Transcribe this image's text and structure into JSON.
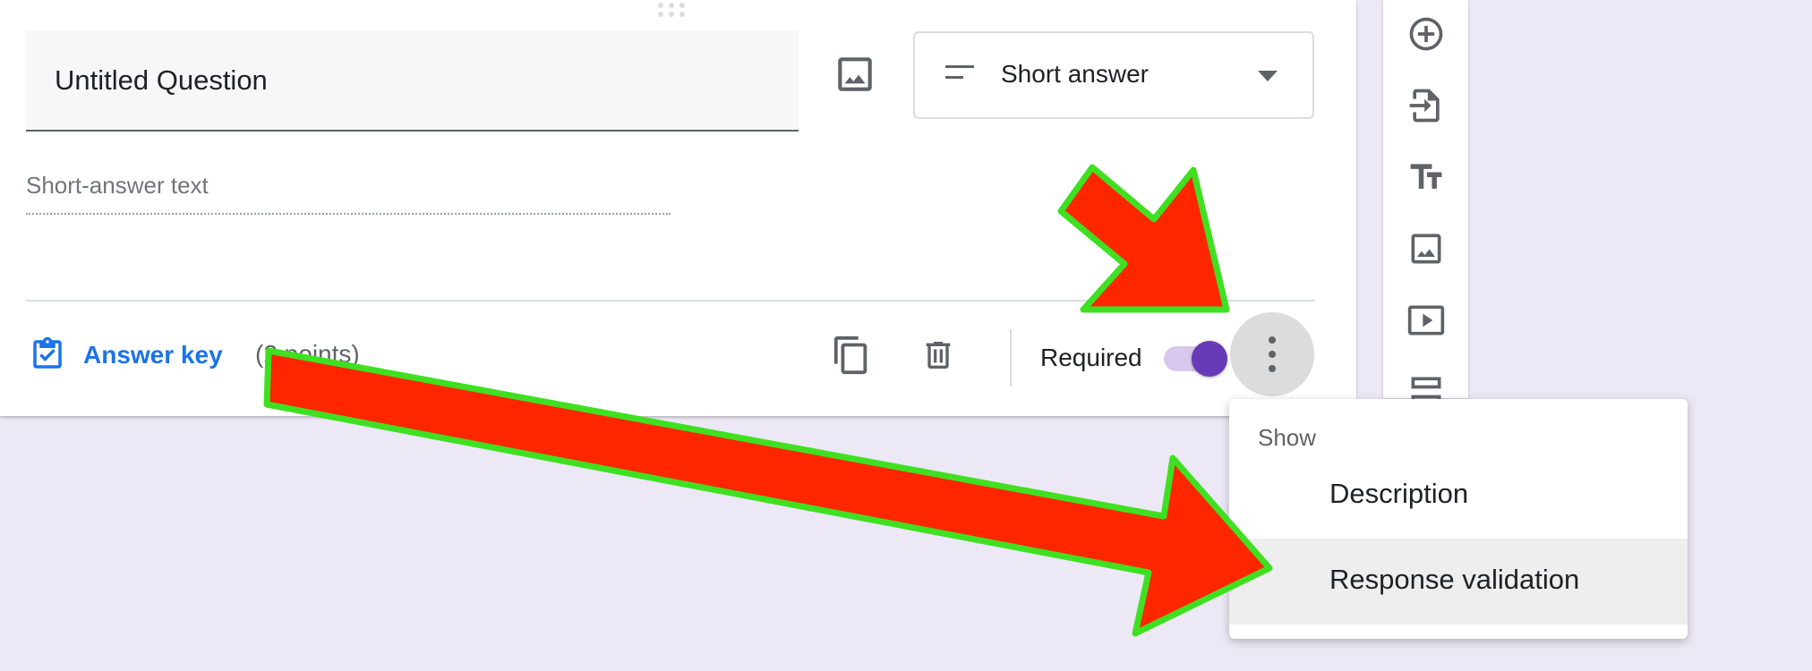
{
  "question": {
    "title": "Untitled Question",
    "type_selected": "Short answer",
    "answer_placeholder": "Short-answer text"
  },
  "footer": {
    "answer_key_label": "Answer key",
    "points_label": "(2 points)",
    "required_label": "Required",
    "required_on": true
  },
  "menu": {
    "header": "Show",
    "items": [
      {
        "label": "Description",
        "highlighted": false
      },
      {
        "label": "Response validation",
        "highlighted": true
      }
    ]
  },
  "toolbar": {
    "icons": [
      "add-question-icon",
      "import-questions-icon",
      "add-title-icon",
      "add-image-icon",
      "add-video-icon",
      "add-section-icon"
    ]
  },
  "colors": {
    "accent": "#673ab7",
    "link": "#1a73e8",
    "background": "#ece8f5",
    "arrow_fill": "#ff2600",
    "arrow_outline": "#3fe021"
  }
}
